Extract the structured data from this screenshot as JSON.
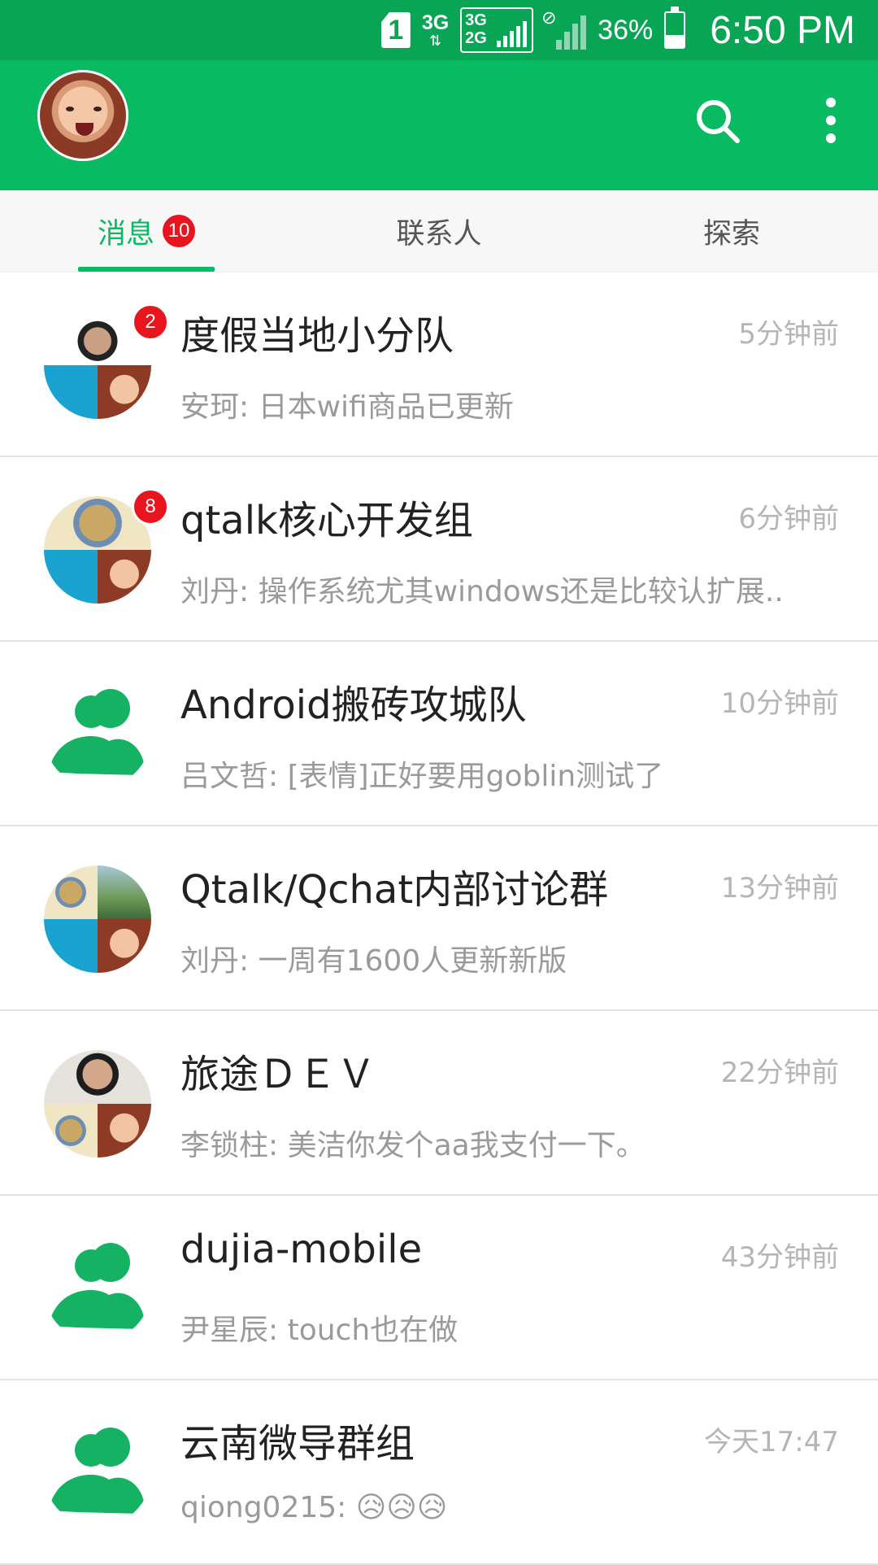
{
  "status_bar": {
    "sim_slot": "1",
    "network_primary": "3G",
    "network_box_line1": "3G",
    "network_box_line2": "2G",
    "battery_percent": "36%",
    "battery_level": 0.36,
    "time": "6:50 PM"
  },
  "app_bar": {
    "avatar_icon": "user-avatar",
    "search_icon": "search-icon",
    "menu_icon": "more-vert-icon"
  },
  "tabs": [
    {
      "label": "消息",
      "badge": "10",
      "active": true
    },
    {
      "label": "联系人",
      "active": false
    },
    {
      "label": "探索",
      "active": false
    }
  ],
  "conversations": [
    {
      "title": "度假当地小分队",
      "time": "5分钟前",
      "preview": "安珂: 日本wifi商品已更新",
      "unread": "2",
      "avatar": "grid-man"
    },
    {
      "title": "qtalk核心开发组",
      "time": "6分钟前",
      "preview": "刘丹: 操作系统尤其windows还是比较认扩展..",
      "unread": "8",
      "avatar": "grid-cartoon"
    },
    {
      "title": "Android搬砖攻城队",
      "time": "10分钟前",
      "preview": "吕文哲: [表情]正好要用goblin测试了",
      "avatar": "group-icon"
    },
    {
      "title": "Qtalk/Qchat内部讨论群",
      "time": "13分钟前",
      "preview": "刘丹: 一周有1600人更新新版",
      "avatar": "grid-four"
    },
    {
      "title": "旅途ＤＥＶ",
      "time": "22分钟前",
      "preview": "李锁柱: 美洁你发个aa我支付一下。",
      "avatar": "grid-man2"
    },
    {
      "title": "dujia-mobile",
      "time": "43分钟前",
      "preview": "尹星辰: touch也在做",
      "avatar": "group-icon"
    },
    {
      "title": "云南微导群组",
      "time": "今天17:47",
      "preview": "qiong0215: 😥😥😥",
      "avatar": "group-icon"
    }
  ],
  "colors": {
    "status_bar": "#07a554",
    "app_bar": "#08bb62",
    "accent": "#08bb62",
    "badge": "#e9141d"
  }
}
